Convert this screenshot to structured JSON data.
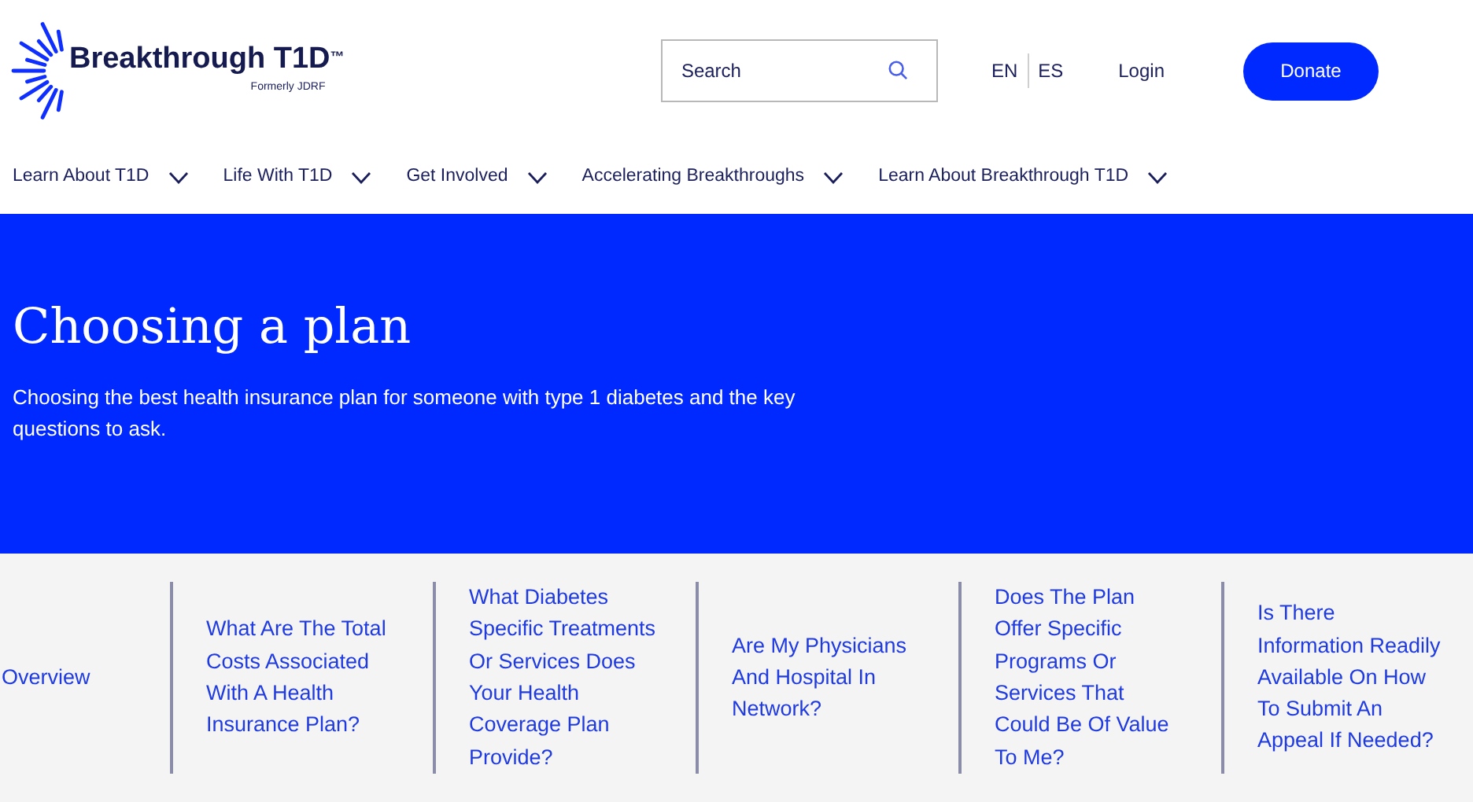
{
  "logo": {
    "name": "Breakthrough T1D",
    "trademark": "™",
    "subtitle": "Formerly JDRF"
  },
  "search": {
    "placeholder": "Search"
  },
  "languages": [
    "EN",
    "ES"
  ],
  "login": "Login",
  "donate": "Donate",
  "nav": [
    "Learn About T1D",
    "Life With T1D",
    "Get Involved",
    "Accelerating Breakthroughs",
    "Learn About Breakthrough T1D"
  ],
  "hero": {
    "title": "Choosing a plan",
    "description": "Choosing the best health insurance plan for someone with type 1 diabetes and the key questions to ask."
  },
  "sections": [
    "Overview",
    "What Are The Total Costs Associated With A Health Insurance Plan?",
    "What Diabetes Specific Treatments Or Services Does Your Health Coverage Plan Provide?",
    "Are My Physicians And Hospital In Network?",
    "Does The Plan Offer Specific Programs Or Services That Could Be Of Value To Me?",
    "Is There Information Readily Available On How To Submit An Appeal If Needed?"
  ]
}
